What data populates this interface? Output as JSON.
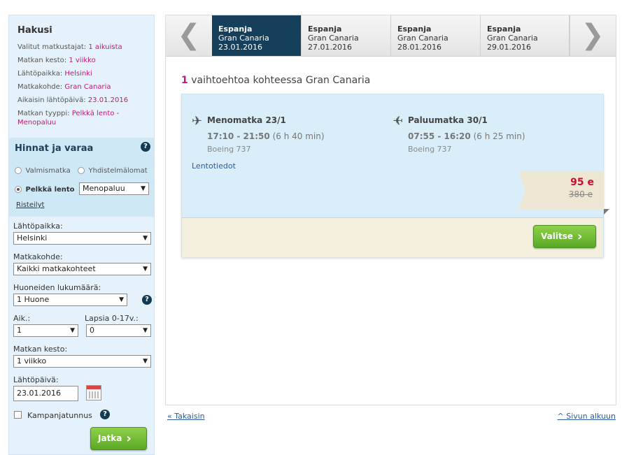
{
  "sidebar": {
    "title": "Hakusi",
    "summary": [
      {
        "label": "Valitut matkustajat:",
        "value": "1 aikuista"
      },
      {
        "label": "Matkan kesto:",
        "value": "1 viikko"
      },
      {
        "label": "Lähtöpaikka:",
        "value": "Helsinki"
      },
      {
        "label": "Matkakohde:",
        "value": "Gran Canaria"
      },
      {
        "label": "Aikaisin lähtöpäivä:",
        "value": "23.01.2016"
      },
      {
        "label": "Matkan tyyppi:",
        "value": "Pelkkä lento - Menopaluu"
      }
    ],
    "prices_title": "Hinnat ja varaa",
    "help_glyph": "?",
    "radio_package": "Valmismatka",
    "radio_combo": "Yhdistelmälomat",
    "radio_flight": "Pelkkä lento",
    "trip_type_selected": "Menopaluu",
    "cruises_link": "Risteilyt",
    "departure_label": "Lähtöpaikka:",
    "departure_value": "Helsinki",
    "destination_label": "Matkakohde:",
    "destination_value": "Kaikki matkakohteet",
    "rooms_label": "Huoneiden lukumäärä:",
    "rooms_value": "1 Huone",
    "adults_label": "Aik.:",
    "adults_value": "1",
    "children_label": "Lapsia 0-17v.:",
    "children_value": "0",
    "duration_label": "Matkan kesto:",
    "duration_value": "1 viikko",
    "date_label": "Lähtöpäivä:",
    "date_value": "23.01.2016",
    "campaign_label": "Kampanjatunnus",
    "continue_label": "Jatka"
  },
  "tabs": [
    {
      "country": "Espanja",
      "city": "Gran Canaria",
      "date": "23.01.2016",
      "active": true
    },
    {
      "country": "Espanja",
      "city": "Gran Canaria",
      "date": "27.01.2016",
      "active": false
    },
    {
      "country": "Espanja",
      "city": "Gran Canaria",
      "date": "28.01.2016",
      "active": false
    },
    {
      "country": "Espanja",
      "city": "Gran Canaria",
      "date": "29.01.2016",
      "active": false
    }
  ],
  "results": {
    "count": "1",
    "count_text": "vaihtoehtoa kohteessa Gran Canaria",
    "outbound": {
      "title": "Menomatka 23/1",
      "times": "17:10 - 21:50",
      "duration": "(6 h 40 min)",
      "aircraft": "Boeing 737"
    },
    "return": {
      "title": "Paluumatka 30/1",
      "times": "07:55 - 16:20",
      "duration": "(6 h 25 min)",
      "aircraft": "Boeing 737"
    },
    "flight_info_link": "Lentotiedot",
    "price": "95 e",
    "old_price": "380 e",
    "select_label": "Valitse"
  },
  "footer": {
    "back_link": "« Takaisin",
    "top_link": "^ Sivun alkuun"
  },
  "colors": {
    "accent": "#c0187b",
    "active_tab": "#153f5a",
    "button_green": "#5aa826",
    "price_red": "#c8102e"
  }
}
